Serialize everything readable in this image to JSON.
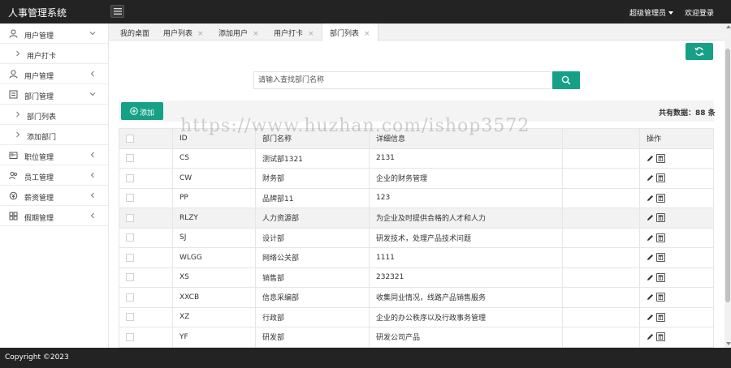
{
  "header": {
    "app_title": "人事管理系统",
    "admin_label": "超级管理员",
    "welcome_label": "欢迎登录"
  },
  "sidebar": {
    "items": [
      {
        "type": "group",
        "label": "用户管理",
        "icon": "user-icon",
        "expanded": true
      },
      {
        "type": "sub",
        "label": "用户打卡"
      },
      {
        "type": "group",
        "label": "用户管理",
        "icon": "user-icon",
        "expanded": false
      },
      {
        "type": "group",
        "label": "部门管理",
        "icon": "department-icon",
        "expanded": true
      },
      {
        "type": "sub",
        "label": "部门列表"
      },
      {
        "type": "sub",
        "label": "添加部门"
      },
      {
        "type": "group",
        "label": "职位管理",
        "icon": "id-card-icon",
        "expanded": false
      },
      {
        "type": "group",
        "label": "员工管理",
        "icon": "staff-icon",
        "expanded": false
      },
      {
        "type": "group",
        "label": "薪资管理",
        "icon": "salary-icon",
        "expanded": false
      },
      {
        "type": "group",
        "label": "假期管理",
        "icon": "grid-icon",
        "expanded": false
      }
    ]
  },
  "tabs": [
    {
      "label": "我的桌面",
      "closable": false
    },
    {
      "label": "用户列表",
      "closable": true
    },
    {
      "label": "添加用户",
      "closable": true
    },
    {
      "label": "用户打卡",
      "closable": true
    },
    {
      "label": "部门列表",
      "closable": true,
      "active": true
    }
  ],
  "search": {
    "placeholder": "请输入查找部门名称",
    "value": ""
  },
  "toolbar": {
    "add_label": "添加",
    "total_label": "共有数据：88 条"
  },
  "table": {
    "columns": [
      "",
      "ID",
      "部门名称",
      "详细信息",
      "",
      "操作"
    ],
    "rows": [
      {
        "id": "CS",
        "name": "测试部1321",
        "detail": "2131"
      },
      {
        "id": "CW",
        "name": "财务部",
        "detail": "企业的财务管理"
      },
      {
        "id": "PP",
        "name": "品牌部11",
        "detail": "123"
      },
      {
        "id": "RLZY",
        "name": "人力资源部",
        "detail": "为企业及时提供合格的人才和人力"
      },
      {
        "id": "SJ",
        "name": "设计部",
        "detail": "研发技术，处理产品技术问题"
      },
      {
        "id": "WLGG",
        "name": "网络公关部",
        "detail": "1111"
      },
      {
        "id": "XS",
        "name": "销售部",
        "detail": "232321"
      },
      {
        "id": "XXCB",
        "name": "信息采编部",
        "detail": "收集同业情况，线路产品销售服务"
      },
      {
        "id": "XZ",
        "name": "行政部",
        "detail": "企业的办公秩序以及行政事务管理"
      },
      {
        "id": "YF",
        "name": "研发部",
        "detail": "研发公司产品"
      }
    ]
  },
  "watermark": "https://www.huzhan.com/ishop3572",
  "footer": {
    "copyright": "Copyright ©2023"
  },
  "colors": {
    "accent": "#16a085",
    "topbar": "#232323"
  }
}
